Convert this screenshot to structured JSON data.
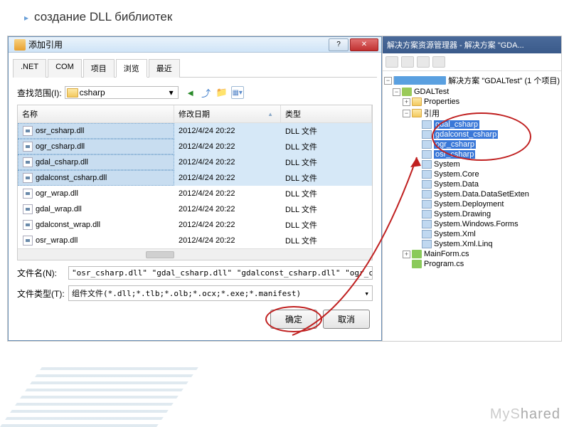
{
  "slide_title": "создание DLL библиотек",
  "dialog": {
    "title": "添加引用",
    "tabs": [
      ".NET",
      "COM",
      "项目",
      "浏览",
      "最近"
    ],
    "active_tab": "浏览",
    "lookin_label": "查找范围(I):",
    "lookin_value": "csharp",
    "columns": {
      "name": "名称",
      "date": "修改日期",
      "type": "类型"
    },
    "files": [
      {
        "name": "osr_csharp.dll",
        "date": "2012/4/24 20:22",
        "type": "DLL 文件",
        "sel": true
      },
      {
        "name": "ogr_csharp.dll",
        "date": "2012/4/24 20:22",
        "type": "DLL 文件",
        "sel": true
      },
      {
        "name": "gdal_csharp.dll",
        "date": "2012/4/24 20:22",
        "type": "DLL 文件",
        "sel": true
      },
      {
        "name": "gdalconst_csharp.dll",
        "date": "2012/4/24 20:22",
        "type": "DLL 文件",
        "sel": true
      },
      {
        "name": "ogr_wrap.dll",
        "date": "2012/4/24 20:22",
        "type": "DLL 文件",
        "sel": false
      },
      {
        "name": "gdal_wrap.dll",
        "date": "2012/4/24 20:22",
        "type": "DLL 文件",
        "sel": false
      },
      {
        "name": "gdalconst_wrap.dll",
        "date": "2012/4/24 20:22",
        "type": "DLL 文件",
        "sel": false
      },
      {
        "name": "osr_wrap.dll",
        "date": "2012/4/24 20:22",
        "type": "DLL 文件",
        "sel": false
      }
    ],
    "filename_label": "文件名(N):",
    "filename_value": "\"osr_csharp.dll\" \"gdal_csharp.dll\" \"gdalconst_csharp.dll\" \"ogr_cshar",
    "filetype_label": "文件类型(T):",
    "filetype_value": "组件文件(*.dll;*.tlb;*.olb;*.ocx;*.exe;*.manifest)",
    "ok": "确定",
    "cancel": "取消"
  },
  "sln": {
    "title": "解决方案资源管理器 - 解决方案 \"GDA...",
    "solution": "解决方案 \"GDALTest\" (1 个项目)",
    "project": "GDALTest",
    "nodes": {
      "properties": "Properties",
      "references": "引用",
      "refs": [
        "gdal_csharp",
        "gdalconst_csharp",
        "ogr_csharp",
        "osr_csharp",
        "System",
        "System.Core",
        "System.Data",
        "System.Data.DataSetExten",
        "System.Deployment",
        "System.Drawing",
        "System.Windows.Forms",
        "System.Xml",
        "System.Xml.Linq"
      ],
      "mainform": "MainForm.cs",
      "program": "Program.cs"
    }
  },
  "watermark_a": "MyS",
  "watermark_b": "hared"
}
